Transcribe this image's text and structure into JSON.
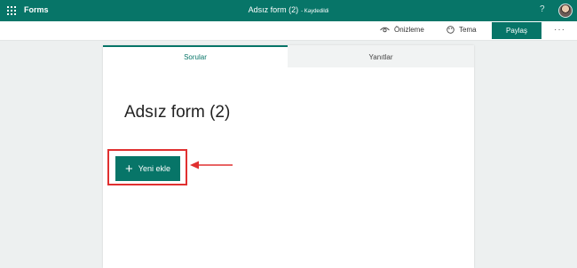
{
  "topbar": {
    "app_name": "Forms",
    "doc_title": "Adsız form (2)",
    "save_status": "- Kaydedildi",
    "help": "?",
    "icons": [
      "app-launcher-icon",
      "help-icon",
      "avatar"
    ]
  },
  "commandbar": {
    "preview_label": "Önizleme",
    "theme_label": "Tema",
    "share_label": "Paylaş",
    "more_label": "···",
    "icons": [
      "eye-icon",
      "palette-icon"
    ]
  },
  "tabs": [
    {
      "label": "Sorular",
      "active": true
    },
    {
      "label": "Yanıtlar",
      "active": false
    }
  ],
  "form": {
    "title": "Adsız form (2)",
    "add_new_label": "Yeni ekle",
    "add_icon": "+"
  },
  "colors": {
    "brand": "#077568",
    "highlight": "#e03030",
    "background": "#edf0f0"
  }
}
